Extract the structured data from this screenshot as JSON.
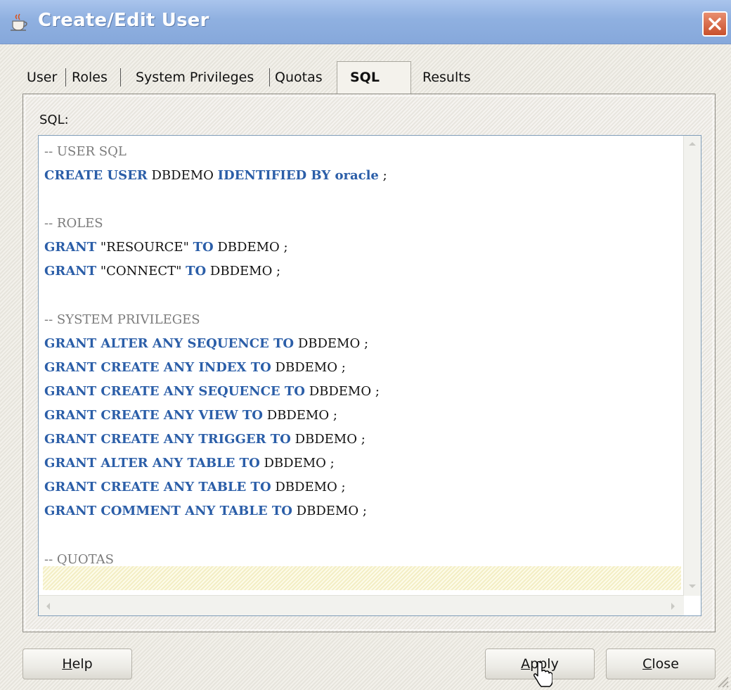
{
  "window": {
    "title": "Create/Edit User",
    "icon": "java-cup-icon",
    "close_icon": "close-x-icon"
  },
  "tabs": [
    {
      "label": "User",
      "active": false
    },
    {
      "label": "Roles",
      "active": false
    },
    {
      "label": "System Privileges",
      "active": false
    },
    {
      "label": "Quotas",
      "active": false
    },
    {
      "label": "SQL",
      "active": true
    },
    {
      "label": "Results",
      "active": false
    }
  ],
  "sql_panel": {
    "label": "SQL:",
    "lines": [
      [
        {
          "t": "-- USER SQL",
          "c": "cm"
        }
      ],
      [
        {
          "t": "CREATE USER",
          "c": "kw"
        },
        {
          "t": " DBDEMO ",
          "c": ""
        },
        {
          "t": "IDENTIFIED BY oracle",
          "c": "kw"
        },
        {
          "t": " ;",
          "c": ""
        }
      ],
      [],
      [
        {
          "t": "-- ROLES",
          "c": "cm"
        }
      ],
      [
        {
          "t": "GRANT",
          "c": "kw"
        },
        {
          "t": " \"RESOURCE\" ",
          "c": ""
        },
        {
          "t": "TO",
          "c": "kw"
        },
        {
          "t": " DBDEMO ;",
          "c": ""
        }
      ],
      [
        {
          "t": "GRANT",
          "c": "kw"
        },
        {
          "t": " \"CONNECT\" ",
          "c": ""
        },
        {
          "t": "TO",
          "c": "kw"
        },
        {
          "t": " DBDEMO ;",
          "c": ""
        }
      ],
      [],
      [
        {
          "t": "-- SYSTEM PRIVILEGES",
          "c": "cm"
        }
      ],
      [
        {
          "t": "GRANT ALTER ANY SEQUENCE TO",
          "c": "kw"
        },
        {
          "t": " DBDEMO ;",
          "c": ""
        }
      ],
      [
        {
          "t": "GRANT CREATE ANY INDEX TO",
          "c": "kw"
        },
        {
          "t": " DBDEMO ;",
          "c": ""
        }
      ],
      [
        {
          "t": "GRANT CREATE ANY SEQUENCE TO",
          "c": "kw"
        },
        {
          "t": " DBDEMO ;",
          "c": ""
        }
      ],
      [
        {
          "t": "GRANT CREATE ANY VIEW TO",
          "c": "kw"
        },
        {
          "t": " DBDEMO ;",
          "c": ""
        }
      ],
      [
        {
          "t": "GRANT CREATE ANY TRIGGER TO",
          "c": "kw"
        },
        {
          "t": " DBDEMO ;",
          "c": ""
        }
      ],
      [
        {
          "t": "GRANT ALTER ANY TABLE TO",
          "c": "kw"
        },
        {
          "t": " DBDEMO ;",
          "c": ""
        }
      ],
      [
        {
          "t": "GRANT CREATE ANY TABLE TO",
          "c": "kw"
        },
        {
          "t": " DBDEMO ;",
          "c": ""
        }
      ],
      [
        {
          "t": "GRANT COMMENT ANY TABLE TO",
          "c": "kw"
        },
        {
          "t": " DBDEMO ;",
          "c": ""
        }
      ],
      [],
      [
        {
          "t": "-- QUOTAS",
          "c": "cm"
        }
      ],
      []
    ]
  },
  "buttons": {
    "help": {
      "label": "Help",
      "mnemonic": "H",
      "rest": "elp"
    },
    "apply": {
      "label": "Apply",
      "mnemonic": "A",
      "rest": "pply"
    },
    "close": {
      "label": "Close",
      "mnemonic": "C",
      "rest": "lose"
    }
  },
  "colors": {
    "keyword": "#2b5ea8",
    "comment": "#7b7b7b",
    "titlebar": "#8fb0e0",
    "current_line": "#fbf7d4"
  }
}
